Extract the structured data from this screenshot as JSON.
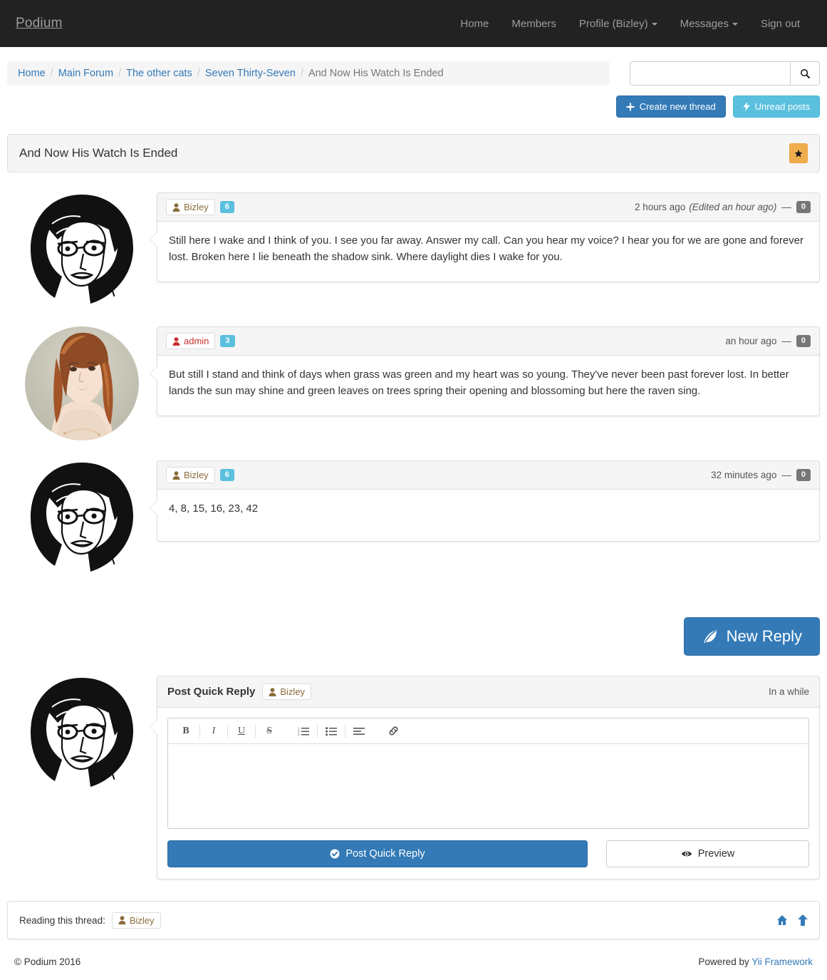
{
  "navbar": {
    "brand": "Podium",
    "links": [
      {
        "label": "Home",
        "caret": false
      },
      {
        "label": "Members",
        "caret": false
      },
      {
        "label": "Profile (Bizley)",
        "caret": true
      },
      {
        "label": "Messages",
        "caret": true
      },
      {
        "label": "Sign out",
        "caret": false
      }
    ]
  },
  "breadcrumb": {
    "items": [
      {
        "label": "Home",
        "active": false
      },
      {
        "label": "Main Forum",
        "active": false
      },
      {
        "label": "The other cats",
        "active": false
      },
      {
        "label": "Seven Thirty-Seven",
        "active": false
      },
      {
        "label": "And Now His Watch Is Ended",
        "active": true
      }
    ],
    "separator": "/"
  },
  "search": {
    "value": "",
    "placeholder": "",
    "icon": "search-icon"
  },
  "actions": {
    "create_thread": "Create new thread",
    "create_thread_icon": "plus-icon",
    "unread_posts": "Unread posts",
    "unread_posts_icon": "bolt-icon"
  },
  "thread": {
    "title": "And Now His Watch Is Ended",
    "subscribe_icon": "star-icon"
  },
  "posts": [
    {
      "author": "Bizley",
      "author_role": "member",
      "author_icon": "user-icon",
      "post_count": "6",
      "time": "2 hours ago",
      "edited": "(Edited an hour ago)",
      "dash": "—",
      "likes": "0",
      "avatar": "bizley-avatar",
      "content": "Still here I wake and I think of you. I see you far away. Answer my call. Can you hear my voice? I hear you for we are gone and forever lost. Broken here I lie beneath the shadow sink. Where daylight dies I wake for you."
    },
    {
      "author": "admin",
      "author_role": "admin",
      "author_icon": "user-icon",
      "post_count": "3",
      "time": "an hour ago",
      "edited": "",
      "dash": "—",
      "likes": "0",
      "avatar": "admin-avatar",
      "content": "But still I stand and think of days when grass was green and my heart was so young. They've never been past forever lost. In better lands the sun may shine and green leaves on trees spring their opening and blossoming but here the raven sing."
    },
    {
      "author": "Bizley",
      "author_role": "member",
      "author_icon": "user-icon",
      "post_count": "6",
      "time": "32 minutes ago",
      "edited": "",
      "dash": "—",
      "likes": "0",
      "avatar": "bizley-avatar",
      "content": "4, 8, 15, 16, 23, 42"
    }
  ],
  "new_reply": {
    "label": "New Reply",
    "icon": "leaf-icon"
  },
  "quick_reply": {
    "title": "Post Quick Reply",
    "author": "Bizley",
    "author_icon": "user-icon",
    "when": "In a while",
    "toolbar": [
      {
        "name": "bold-icon",
        "glyph": "B"
      },
      {
        "name": "italic-icon",
        "glyph": "I"
      },
      {
        "name": "underline-icon",
        "glyph": "U"
      },
      {
        "name": "strikethrough-icon",
        "glyph": "S"
      },
      {
        "name": "ordered-list-icon",
        "glyph": ""
      },
      {
        "name": "unordered-list-icon",
        "glyph": ""
      },
      {
        "name": "align-left-icon",
        "glyph": ""
      },
      {
        "name": "link-icon",
        "glyph": ""
      }
    ],
    "textarea_value": "",
    "textarea_placeholder": "",
    "submit_label": "Post Quick Reply",
    "submit_icon": "check-circle-icon",
    "preview_label": "Preview",
    "preview_icon": "eye-icon"
  },
  "reading": {
    "label": "Reading this thread:",
    "users": [
      {
        "name": "Bizley",
        "icon": "user-icon"
      }
    ],
    "home_icon": "home-icon",
    "top_icon": "arrow-up-icon"
  },
  "footer": {
    "copyright": "© Podium 2016",
    "powered_prefix": "Powered by ",
    "powered_link": "Yii Framework"
  },
  "colors": {
    "navbar_bg": "#222222",
    "primary": "#337ab7",
    "info": "#5bc0de",
    "warning": "#f0ad4e",
    "member_text": "#8a6d3b",
    "admin_text": "#c9302c",
    "gray_badge": "#777777"
  }
}
